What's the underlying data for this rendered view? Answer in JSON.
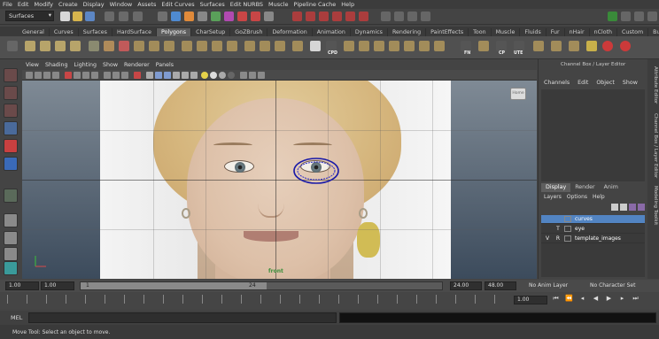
{
  "menubar": [
    "File",
    "Edit",
    "Modify",
    "Create",
    "Display",
    "Window",
    "Assets",
    "Edit Curves",
    "Surfaces",
    "Edit NURBS",
    "Muscle",
    "Pipeline Cache",
    "Help"
  ],
  "statusline": {
    "mode": "Surfaces"
  },
  "shelf": {
    "tabs": [
      "General",
      "Curves",
      "Surfaces",
      "HardSurface",
      "Polygons",
      "CharSetup",
      "GoZBrush",
      "Deformation",
      "Animation",
      "Dynamics",
      "Rendering",
      "PaintEffects",
      "Toon",
      "Muscle",
      "Fluids",
      "Fur",
      "nHair",
      "nCloth",
      "Custom",
      "Bullet"
    ],
    "active_tab": "Polygons",
    "labels": [
      "CPD",
      "FN",
      "CP",
      "UTE"
    ]
  },
  "panel": {
    "menu": [
      "View",
      "Shading",
      "Lighting",
      "Show",
      "Renderer",
      "Panels"
    ],
    "camera": "front",
    "home_button": "Home"
  },
  "channel_box": {
    "title": "Channel Box / Layer Editor",
    "menu": [
      "Channels",
      "Edit",
      "Object",
      "Show"
    ],
    "layer_tabs": [
      "Display",
      "Render",
      "Anim"
    ],
    "active_layer_tab": "Display",
    "layer_menu": [
      "Layers",
      "Options",
      "Help"
    ],
    "layers": [
      {
        "v": "",
        "t": "",
        "name": "curves",
        "selected": true
      },
      {
        "v": "",
        "t": "T",
        "name": "eye",
        "selected": false
      },
      {
        "v": "V",
        "t": "R",
        "name": "template_images",
        "selected": false
      }
    ]
  },
  "side_tabs": [
    "Attribute Editor",
    "Channel Box / Layer Editor",
    "Modeling Toolkit"
  ],
  "time": {
    "start": "1.00",
    "playback_start": "1.00",
    "range_start": "1",
    "range_end": "24",
    "playback_end": "24.00",
    "end": "48.00",
    "anim_layer": "No Anim Layer",
    "character_set": "No Character Set",
    "current": "1.00"
  },
  "cmdline": {
    "label": "MEL"
  },
  "helpline": "Move Tool: Select an object to move.",
  "colors": {
    "accent": "#5284c2",
    "curve": "#1a1aa8",
    "camera_label": "#3a8f3a"
  }
}
